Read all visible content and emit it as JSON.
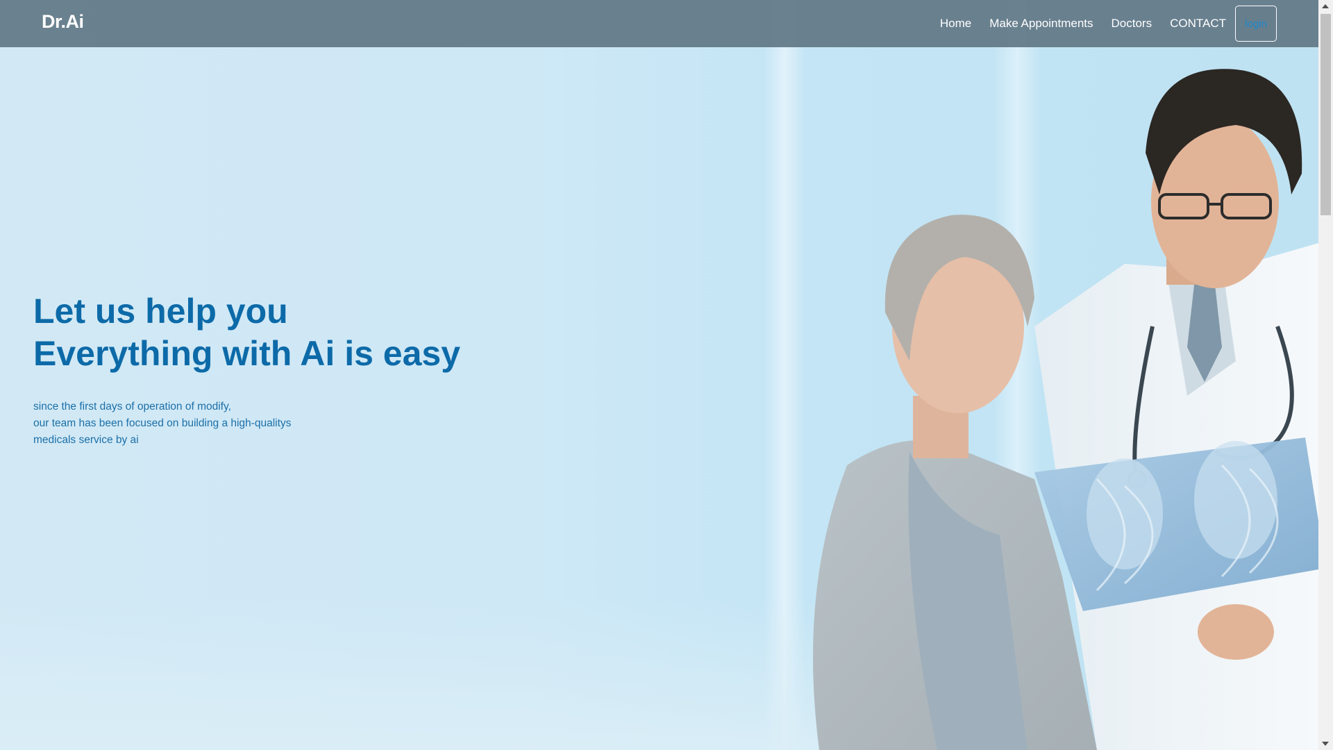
{
  "navbar": {
    "brand": "Dr.Ai",
    "links": [
      "Home",
      "Make Appointments",
      "Doctors",
      "CONTACT"
    ],
    "login_label": "login"
  },
  "hero": {
    "headline_line1": "Let us help you",
    "headline_line2": "Everything with Ai is easy",
    "subtext_lines": [
      "since the first days of operation of modify,",
      "our team has been focused on building a high-qualitys",
      "medicals service by ai"
    ],
    "image": "doctor-with-patient-xray-photo"
  },
  "colors": {
    "navbar_bg": "#657c8a",
    "headline": "#0d6aa8",
    "subtext": "#1b6fa8",
    "login_text": "#1b88c9",
    "hero_bg": "#d3eaf5"
  }
}
